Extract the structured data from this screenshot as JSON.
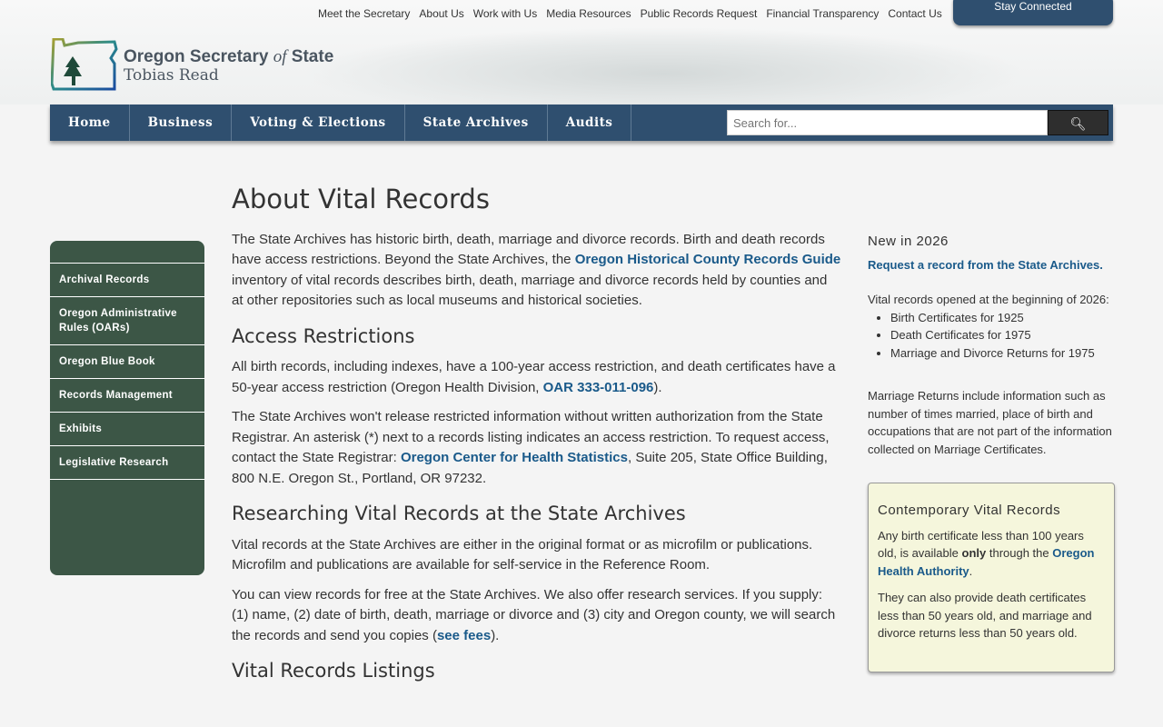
{
  "utility_nav": [
    "Meet the Secretary",
    "About Us",
    "Work with Us",
    "Media Resources",
    "Public Records Request",
    "Financial Transparency",
    "Contact Us"
  ],
  "stay_connected": "Stay Connected",
  "logo": {
    "line1a": "Oregon Secretary ",
    "line1b": "of",
    "line1c": " State",
    "line2": "Tobias Read"
  },
  "main_nav": [
    "Home",
    "Business",
    "Voting & Elections",
    "State Archives",
    "Audits"
  ],
  "search": {
    "placeholder": "Search for...",
    "button_icon": "search-icon"
  },
  "sidebar": [
    "Archival Records",
    "Oregon Administrative Rules (OARs)",
    "Oregon Blue Book",
    "Records Management",
    "Exhibits",
    "Legislative Research"
  ],
  "main": {
    "title": "About Vital Records",
    "p1": [
      "The State Archives has historic birth, death, marriage and divorce records. Birth and death records have access restrictions. Beyond the State Archives, the ",
      "Oregon Historical County Records Guide",
      " inventory of vital records describes birth, death, marriage and divorce records held by counties and at other repositories such as local museums and historical societies."
    ],
    "h_access": "Access Restrictions",
    "p2": [
      "All birth records, including indexes, have a 100-year access restriction, and death certificates have a 50-year access restriction (Oregon Health Division, ",
      "OAR 333-011-096",
      "). "
    ],
    "p3": [
      "The State Archives won't release restricted information without written authorization from the State Registrar. An asterisk (*) next to a records listing indicates an access restriction. To request access, contact the State Registrar: ",
      "Oregon Center for Health Statistics",
      ", Suite 205, State Office Building, 800 N.E. Oregon St., Portland, OR 97232."
    ],
    "h_research": "Researching Vital Records at the State Archives",
    "p4": "Vital records at the State Archives are either in the original format or as microfilm or publications. Microfilm and publications are available for self-service in the Reference Room.",
    "p5": [
      "You can view records for free at the State Archives. We also offer research services. If you supply: (1) name, (2) date of birth, death, marriage or divorce and (3) city and Oregon county, we will search the records and send you copies (",
      "see fees",
      "). "
    ],
    "h_listings": "Vital Records Listings"
  },
  "right": {
    "heading": "New in 2026",
    "link": "Request a record from the State Archives.",
    "intro": "Vital records opened at the beginning of 2026:",
    "items": [
      "Birth Certificates for 1925",
      "Death Certificates for 1975",
      "Marriage and Divorce Returns for 1975"
    ],
    "note": "Marriage Returns include information such as number of times married, place of birth and occupations that are not part of the information collected on Marriage Certificates.",
    "box": {
      "title": "Contemporary Vital Records",
      "p1a": "Any birth certificate less than 100 years old, is available ",
      "p1b": "only",
      "p1c": " through the ",
      "p1link": "Oregon Health Authority",
      "p1d": ".",
      "p2": "They can also provide death certificates less than 50 years old, and marriage and divorce returns less than 50 years old."
    }
  }
}
